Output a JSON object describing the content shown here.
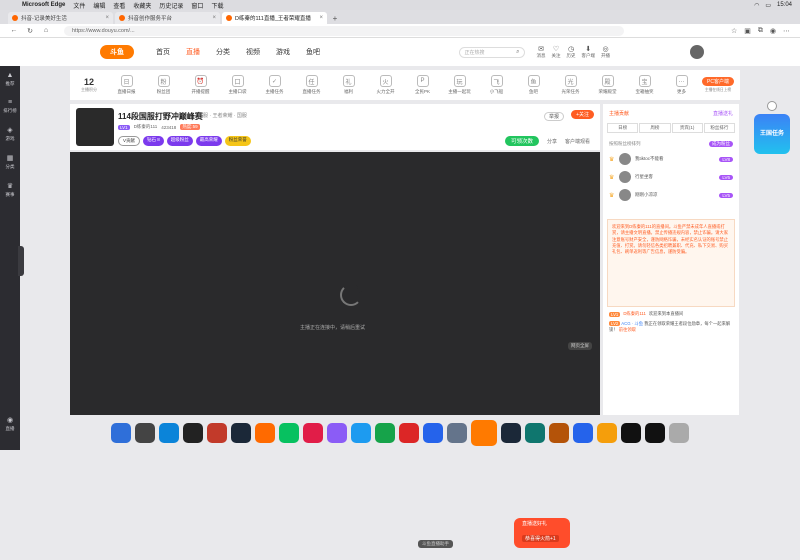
{
  "menubar": {
    "app": "Microsoft Edge",
    "menus": [
      "文件",
      "编辑",
      "查看",
      "收藏夹",
      "历史记录",
      "窗口",
      "下载"
    ],
    "status_time": "15:04"
  },
  "tabs": [
    {
      "title": "抖音-记录美好生活"
    },
    {
      "title": "抖音创作服务平台"
    },
    {
      "title": "D练秦的111直播_王者荣耀直播"
    }
  ],
  "address": {
    "url": "https://www.douyu.com/..."
  },
  "site": {
    "logo_text": "斗鱼",
    "nav": [
      "首页",
      "直播",
      "分类",
      "视频",
      "游戏",
      "鱼吧"
    ],
    "search_placeholder": "正在热搜",
    "header_icons": [
      "消息",
      "关注",
      "历史",
      "客户端",
      "开播"
    ]
  },
  "sidebar": {
    "items": [
      "推荐",
      "排行榜",
      "游戏",
      "分类",
      "赛事",
      "直播"
    ]
  },
  "ribbon": {
    "level_value": "12",
    "level_label": "主播积分",
    "items": [
      {
        "label": "直播日报",
        "icon": "日"
      },
      {
        "label": "粉丝团",
        "icon": "粉"
      },
      {
        "label": "开播提醒",
        "icon": "⏰"
      },
      {
        "label": "主播口袋",
        "icon": "口"
      },
      {
        "label": "主播任务",
        "icon": "✓"
      },
      {
        "label": "直播任务",
        "icon": "任"
      },
      {
        "label": "福利",
        "icon": "礼"
      },
      {
        "label": "火力全开",
        "icon": "火"
      },
      {
        "label": "全民PK",
        "icon": "P"
      },
      {
        "label": "主播一起玩",
        "icon": "玩"
      },
      {
        "label": "小飞船",
        "icon": "飞"
      },
      {
        "label": "鱼吧",
        "icon": "鱼"
      },
      {
        "label": "光荣任务",
        "icon": "光"
      },
      {
        "label": "荣耀殿堂",
        "icon": "殿"
      },
      {
        "label": "宝箱抽奖",
        "icon": "宝"
      },
      {
        "label": "更多",
        "icon": "…"
      }
    ],
    "pc_button": "PC客户端",
    "pc_sub": "主播在线日上榜"
  },
  "room": {
    "title": "114段国服打野冲巅峰赛",
    "tag": "韩服 · 王者荣耀 · 国服",
    "level": "LV1",
    "anchor": "D练秦的111",
    "id": "423418",
    "viewers": "热度:59",
    "badges": [
      "V贡献",
      "钻石 8",
      "超级粉丝",
      "最高荣耀",
      "粉丝荣誉"
    ],
    "report": "举报",
    "follow": "+关注",
    "tip_btn": "可领次数",
    "share": "分享",
    "client": "客户端观看"
  },
  "player": {
    "loading": "主播正在连接中，请稍后重试",
    "fullscreen": "网页全屏",
    "promo_title": "直播送好礼",
    "promo_sub": "恭喜得火箭+1",
    "tooltip": "斗鱼直播助手"
  },
  "chat": {
    "contrib_tab": "主播贡献",
    "fans_tab": "直播送礼",
    "tabs": [
      "日榜",
      "周榜",
      "贵宾(1)",
      "粉丝排行"
    ],
    "rank_label": "按照粉丝榜排列",
    "rank_btn": "成为粉丝",
    "fans": [
      {
        "name": "我tiktoc不能看",
        "level": "LV8"
      },
      {
        "name": "行星坐客",
        "level": "LV6"
      },
      {
        "name": "刚刚小凉凉",
        "level": "LV5"
      }
    ],
    "notice": "欢迎来到D练秦的111的直播间。斗鱼严禁未成年人直播或打赏，请主播文明直播。禁止传播违规内容，禁止诈骗。请大家注意账号财产安全，谨防网络诈骗，未经实名认证的账号禁止充值、打赏。请勿轻信各类招聘兼职、代充、私下交易、购买礼包、刷单返利等广告信息，谨防受骗。",
    "welcome_level": "LV1",
    "welcome_name": "D练秦的111",
    "welcome_text": "欢迎来到本直播间",
    "msg_level": "LV2",
    "msg_name": "ACG · 斗鱼",
    "msg_text": "我正在领取荣耀王者段位勋章，每个一起来解锁！",
    "msg_link": "前往领取",
    "float_badge": "王国任务"
  },
  "dock": {
    "apps": [
      "finder-icon",
      "launchpad-icon",
      "edge-icon",
      "terminal-icon",
      "game-icon",
      "steam-icon",
      "taobao-icon",
      "wechat-icon",
      "music-icon",
      "video-icon",
      "qq-icon",
      "maps-icon",
      "netease-icon",
      "zoom-icon",
      "folder-icon",
      "douyu-icon",
      "steam2-icon",
      "league-icon",
      "game2-icon",
      "xcode-icon",
      "notes-icon",
      "media-icon",
      "capcut-icon",
      "trash-icon"
    ],
    "colors": [
      "#2f6fd9",
      "#444",
      "#0b84d9",
      "#222",
      "#c23a2a",
      "#1b2838",
      "#ff6a00",
      "#07c160",
      "#e11d48",
      "#8b5cf6",
      "#1d9bf0",
      "#16a34a",
      "#dc2626",
      "#2563eb",
      "#64748b",
      "#ff7a00",
      "#1b2838",
      "#0f766e",
      "#b45309",
      "#2563eb",
      "#f59e0b",
      "#111",
      "#111",
      "#aaa"
    ]
  }
}
